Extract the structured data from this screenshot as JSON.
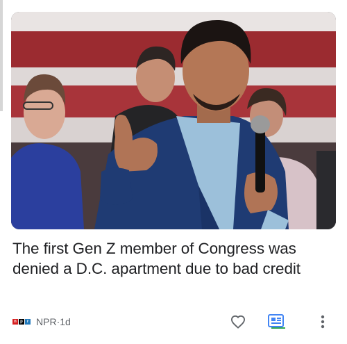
{
  "article": {
    "image_alt": "",
    "headline": "The first Gen Z member of Congress was denied a D.C. apartment due to bad credit",
    "source": {
      "logo_letters": [
        "n",
        "p",
        "r"
      ],
      "logo_colors": [
        "#d62021",
        "#000000",
        "#237bbd"
      ],
      "name": "NPR",
      "separator": " · ",
      "age": "1d"
    }
  },
  "actions": {
    "save_icon": "heart-icon",
    "full_coverage_icon": "full-coverage-icon",
    "more_icon": "more-vert-icon"
  },
  "colors": {
    "text_primary": "#202124",
    "text_secondary": "#5f6368",
    "full_coverage_blue": "#4285f4",
    "full_coverage_green": "#34a853"
  }
}
